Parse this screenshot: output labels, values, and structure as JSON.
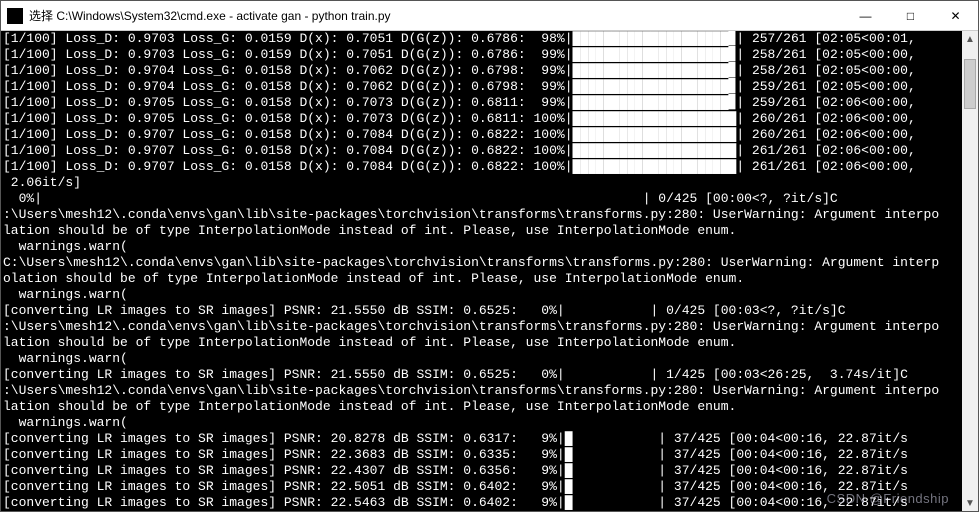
{
  "titlebar": {
    "prefix": "选择",
    "title": "C:\\Windows\\System32\\cmd.exe - activate  gan - python  train.py",
    "min_label": "—",
    "max_label": "□",
    "close_label": "✕"
  },
  "console": {
    "training_lines": [
      {
        "epoch": "[1/100]",
        "loss_d": "0.9703",
        "loss_g": "0.0159",
        "dx": "0.7051",
        "dgz": "0.6786",
        "pct": " 98%",
        "counter": "257/261",
        "eta": "[02:05<00:01,"
      },
      {
        "epoch": "[1/100]",
        "loss_d": "0.9703",
        "loss_g": "0.0159",
        "dx": "0.7051",
        "dgz": "0.6786",
        "pct": " 99%",
        "counter": "258/261",
        "eta": "[02:05<00:00,"
      },
      {
        "epoch": "[1/100]",
        "loss_d": "0.9704",
        "loss_g": "0.0158",
        "dx": "0.7062",
        "dgz": "0.6798",
        "pct": " 99%",
        "counter": "258/261",
        "eta": "[02:05<00:00,"
      },
      {
        "epoch": "[1/100]",
        "loss_d": "0.9704",
        "loss_g": "0.0158",
        "dx": "0.7062",
        "dgz": "0.6798",
        "pct": " 99%",
        "counter": "259/261",
        "eta": "[02:05<00:00,"
      },
      {
        "epoch": "[1/100]",
        "loss_d": "0.9705",
        "loss_g": "0.0158",
        "dx": "0.7073",
        "dgz": "0.6811",
        "pct": " 99%",
        "counter": "259/261",
        "eta": "[02:06<00:00,"
      },
      {
        "epoch": "[1/100]",
        "loss_d": "0.9705",
        "loss_g": "0.0158",
        "dx": "0.7073",
        "dgz": "0.6811",
        "pct": "100%",
        "counter": "260/261",
        "eta": "[02:06<00:00,"
      },
      {
        "epoch": "[1/100]",
        "loss_d": "0.9707",
        "loss_g": "0.0158",
        "dx": "0.7084",
        "dgz": "0.6822",
        "pct": "100%",
        "counter": "260/261",
        "eta": "[02:06<00:00,"
      },
      {
        "epoch": "[1/100]",
        "loss_d": "0.9707",
        "loss_g": "0.0158",
        "dx": "0.7084",
        "dgz": "0.6822",
        "pct": "100%",
        "counter": "261/261",
        "eta": "[02:06<00:00,"
      },
      {
        "epoch": "[1/100]",
        "loss_d": "0.9707",
        "loss_g": "0.0158",
        "dx": "0.7084",
        "dgz": "0.6822",
        "pct": "100%",
        "counter": "261/261",
        "eta": "[02:06<00:00,"
      }
    ],
    "training_trailer": " 2.06it/s]",
    "zero_line": "  0%|                                                                             | 0/425 [00:00<?, ?it/s]C",
    "warn_path": ":\\Users\\mesh12\\.conda\\envs\\gan\\lib\\site-packages\\torchvision\\transforms\\transforms.py:280: UserWarning: Argument interpo",
    "warn_path_C": "C:\\Users\\mesh12\\.conda\\envs\\gan\\lib\\site-packages\\torchvision\\transforms\\transforms.py:280: UserWarning: Argument interp",
    "warn_body1": "lation should be of type InterpolationMode instead of int. Please, use InterpolationMode enum.",
    "warn_body2": "olation should be of type InterpolationMode instead of int. Please, use InterpolationMode enum.",
    "warn_warn": "  warnings.warn(",
    "conv_0a": "[converting LR images to SR images] PSNR: 21.5550 dB SSIM: 0.6525:   0%|           | 0/425 [00:03<?, ?it/s]C",
    "conv_0b_full": "[converting LR images to SR images] PSNR: 21.5550 dB SSIM: 0.6525:   0%|           | 1/425 [00:03<26:25,  3.74s/it]C",
    "conv_9": [
      {
        "psnr": "20.8278",
        "ssim": "0.6317",
        "pct": "9%",
        "counter": "37/425",
        "eta": "[00:04<00:16, 22.87it/s"
      },
      {
        "psnr": "22.3683",
        "ssim": "0.6335",
        "pct": "9%",
        "counter": "37/425",
        "eta": "[00:04<00:16, 22.87it/s"
      },
      {
        "psnr": "22.4307",
        "ssim": "0.6356",
        "pct": "9%",
        "counter": "37/425",
        "eta": "[00:04<00:16, 22.87it/s"
      },
      {
        "psnr": "22.5051",
        "ssim": "0.6402",
        "pct": "9%",
        "counter": "37/425",
        "eta": "[00:04<00:16, 22.87it/s"
      },
      {
        "psnr": "22.5463",
        "ssim": "0.6402",
        "pct": "9%",
        "counter": "37/425",
        "eta": "[00:04<00:16, 22.87it/s"
      }
    ]
  },
  "watermark": "CSDN @Friendship",
  "training_bar_seg": "████████████████████▉",
  "training_bar_seg_full": "█████████████████████",
  "conv9_bar": "█"
}
